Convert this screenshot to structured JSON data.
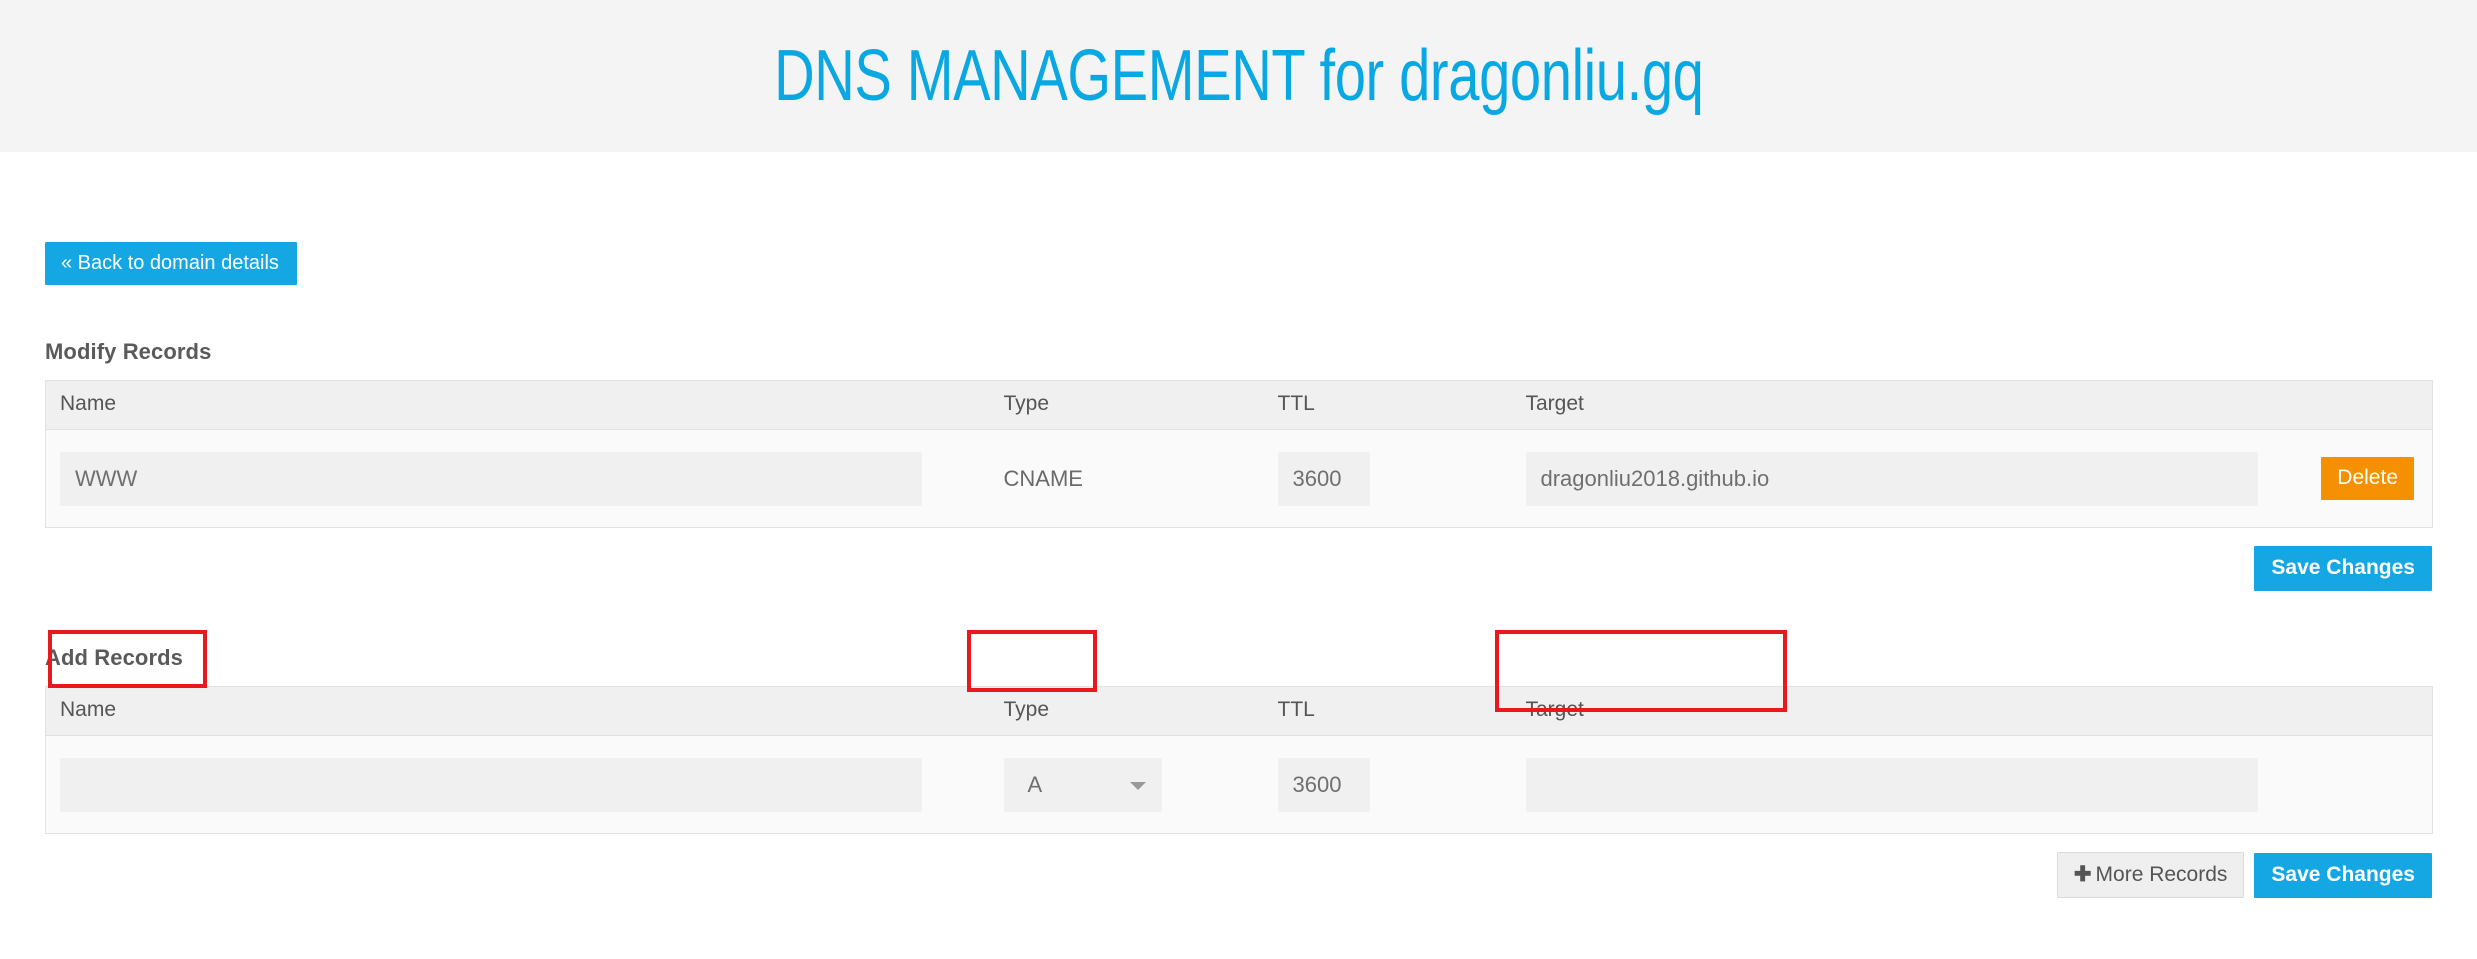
{
  "header": {
    "title": "DNS MANAGEMENT for dragonliu.gq",
    "title_color": "#0aa8e2",
    "band_color": "#f4f4f4"
  },
  "nav": {
    "back_label": "« Back to domain details"
  },
  "modify_section": {
    "heading": "Modify Records",
    "columns": {
      "name": "Name",
      "type": "Type",
      "ttl": "TTL",
      "target": "Target"
    },
    "rows": [
      {
        "name": "WWW",
        "type": "CNAME",
        "ttl": "3600",
        "target": "dragonliu2018.github.io",
        "delete_label": "Delete"
      }
    ],
    "save_label": "Save Changes"
  },
  "add_section": {
    "heading": "Add Records",
    "columns": {
      "name": "Name",
      "type": "Type",
      "ttl": "TTL",
      "target": "Target"
    },
    "rows": [
      {
        "name": "",
        "type": "A",
        "ttl": "3600",
        "target": ""
      }
    ],
    "more_records_label": "More Records",
    "more_records_glyph": "✚",
    "save_label": "Save Changes"
  },
  "annotations": {
    "color": "#e8181c",
    "boxes": [
      {
        "name": "name-field-highlight"
      },
      {
        "name": "type-field-highlight"
      },
      {
        "name": "target-field-highlight"
      }
    ]
  },
  "colors": {
    "primary": "#14a7e4",
    "danger": "#f59000",
    "field_bg": "#f0f0f0",
    "table_header_bg": "#f0f0f0",
    "table_body_bg": "#fafafa"
  }
}
